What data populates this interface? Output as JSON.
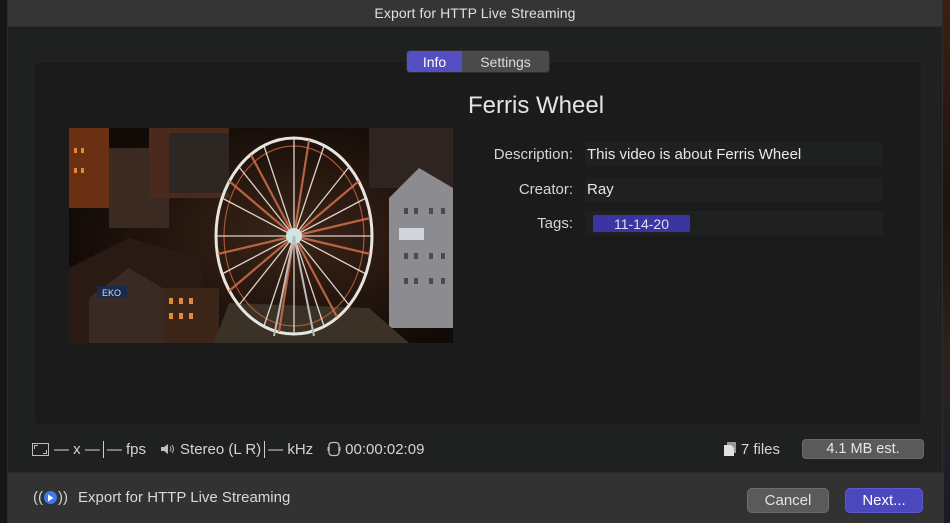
{
  "window": {
    "title": "Export for HTTP Live Streaming"
  },
  "tabs": [
    {
      "label": "Info",
      "active": true
    },
    {
      "label": "Settings",
      "active": false
    }
  ],
  "video": {
    "title": "Ferris Wheel",
    "thumbnail_alt": "Night aerial view of an illuminated Ferris wheel among city buildings"
  },
  "fields": {
    "description": {
      "label": "Description:",
      "value": "This video is about Ferris Wheel"
    },
    "creator": {
      "label": "Creator:",
      "value": "Ray"
    },
    "tags": {
      "label": "Tags:",
      "values": [
        "11-14-20"
      ]
    }
  },
  "status": {
    "resolution": "— x —",
    "fps": "— fps",
    "audio": "Stereo (L R)",
    "sample_rate": "— kHz",
    "duration": "00:00:02:09",
    "files": "7 files",
    "size_estimate": "4.1 MB est."
  },
  "footer": {
    "export_label": "Export for HTTP Live Streaming",
    "cancel_label": "Cancel",
    "next_label": "Next..."
  },
  "colors": {
    "accent": "#5450c4",
    "tag": "#3a35a0",
    "hls_icon": "#3f78f0"
  }
}
